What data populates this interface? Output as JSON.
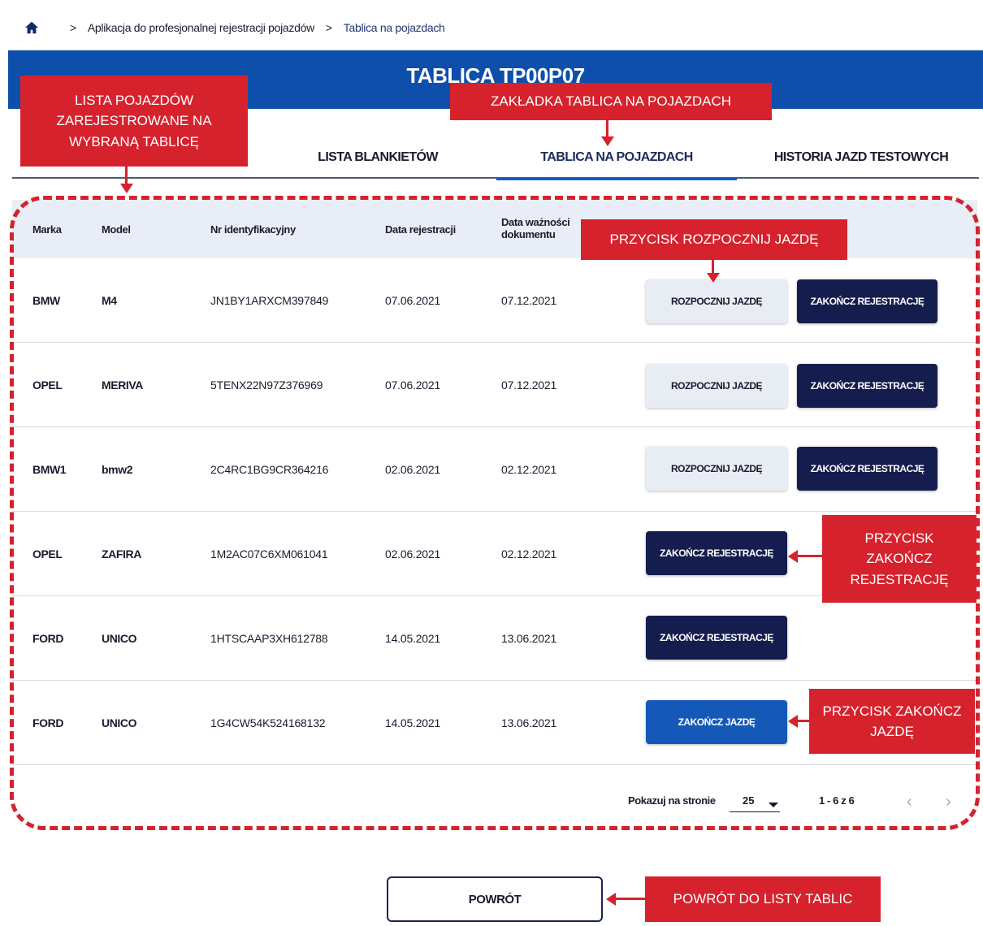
{
  "breadcrumb": {
    "home_icon": "home-icon",
    "separator": ">",
    "items": [
      "Aplikacja do profesjonalnej rejestracji pojazdów",
      "Tablica na pojazdach"
    ]
  },
  "header": {
    "title": "TABLICA TP00P07"
  },
  "tabs": [
    {
      "label": "LISTA BLANKIETÓW",
      "active": false
    },
    {
      "label": "TABLICA NA POJAZDACH",
      "active": true
    },
    {
      "label": "HISTORIA JAZD TESTOWYCH",
      "active": false
    }
  ],
  "table": {
    "columns": [
      "Marka",
      "Model",
      "Nr identyfikacyjny",
      "Data rejestracji",
      "Data ważności dokumentu"
    ],
    "rows": [
      {
        "marka": "BMW",
        "model": "M4",
        "id": "JN1BY1ARXCM397849",
        "reg": "07.06.2021",
        "valid": "07.12.2021",
        "start": "ROZPOCZNIJ JAZDĘ",
        "end": "ZAKOŃCZ REJESTRACJĘ"
      },
      {
        "marka": "OPEL",
        "model": "MERIVA",
        "id": "5TENX22N97Z376969",
        "reg": "07.06.2021",
        "valid": "07.12.2021",
        "start": "ROZPOCZNIJ JAZDĘ",
        "end": "ZAKOŃCZ REJESTRACJĘ"
      },
      {
        "marka": "BMW1",
        "model": "bmw2",
        "id": "2C4RC1BG9CR364216",
        "reg": "02.06.2021",
        "valid": "02.12.2021",
        "start": "ROZPOCZNIJ JAZDĘ",
        "end": "ZAKOŃCZ REJESTRACJĘ"
      },
      {
        "marka": "OPEL",
        "model": "ZAFIRA",
        "id": "1M2AC07C6XM061041",
        "reg": "02.06.2021",
        "valid": "02.12.2021",
        "end": "ZAKOŃCZ REJESTRACJĘ"
      },
      {
        "marka": "FORD",
        "model": "UNICO",
        "id": "1HTSCAAP3XH612788",
        "reg": "14.05.2021",
        "valid": "13.06.2021",
        "end": "ZAKOŃCZ REJESTRACJĘ"
      },
      {
        "marka": "FORD",
        "model": "UNICO",
        "id": "1G4CW54K524168132",
        "reg": "14.05.2021",
        "valid": "13.06.2021",
        "finish": "ZAKOŃCZ JAZDĘ"
      }
    ]
  },
  "pagination": {
    "per_page_label": "Pokazuj na stronie",
    "per_page_value": "25",
    "range": "1 - 6 z 6",
    "prev": "‹",
    "next": "›"
  },
  "back_button": "POWRÓT",
  "annotations": {
    "vehicle_list": "LISTA POJAZDÓW ZAREJESTROWANE NA WYBRANĄ TABLICĘ",
    "tab": "ZAKŁADKA TABLICA NA POJAZDACH",
    "start_ride": "PRZYCISK ROZPOCZNIJ JAZDĘ",
    "end_registration": "PRZYCISK ZAKOŃCZ REJESTRACJĘ",
    "end_ride": "PRZYCISK ZAKOŃCZ JAZDĘ",
    "back": "POWRÓT DO LISTY TABLIC"
  },
  "colors": {
    "header": "#0d4faa",
    "accent_red": "#d5222d",
    "dark_button": "#141d4d",
    "blue_button": "#1559b8",
    "light_button": "#e8edf4",
    "table_head": "#e9eef6"
  }
}
